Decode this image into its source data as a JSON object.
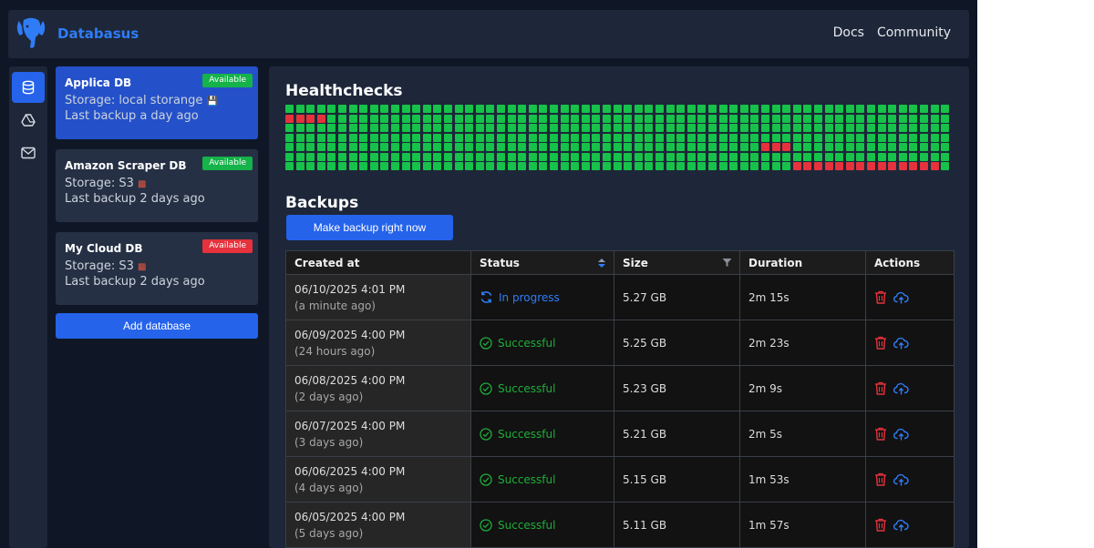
{
  "app": {
    "brand": "Databasus"
  },
  "nav": {
    "docs": "Docs",
    "community": "Community"
  },
  "sidebar": {
    "databases": [
      {
        "name": "Applica DB",
        "status": "Available",
        "storage": "Storage: local storange",
        "last_backup": "Last backup a day ago"
      },
      {
        "name": "Amazon Scraper DB",
        "status": "Available",
        "storage": "Storage: S3",
        "last_backup": "Last backup 2 days ago"
      },
      {
        "name": "My Cloud DB",
        "status": "Available",
        "storage": "Storage: S3",
        "last_backup": "Last backup 2 days ago"
      }
    ],
    "add_button": "Add database"
  },
  "healthchecks": {
    "title": "Healthchecks",
    "colors": {
      "ok": "#16c24a",
      "fail": "#e5323c"
    }
  },
  "backups": {
    "title": "Backups",
    "make_button": "Make backup right now",
    "columns": {
      "created": "Created at",
      "status": "Status",
      "size": "Size",
      "duration": "Duration",
      "actions": "Actions"
    },
    "rows": [
      {
        "created": "06/10/2025 4:01 PM",
        "ago": "(a minute ago)",
        "status": "In progress",
        "size": "5.27 GB",
        "duration": "2m 15s"
      },
      {
        "created": "06/09/2025 4:00 PM",
        "ago": "(24 hours ago)",
        "status": "Successful",
        "size": "5.25 GB",
        "duration": "2m 23s"
      },
      {
        "created": "06/08/2025 4:00 PM",
        "ago": "(2 days ago)",
        "status": "Successful",
        "size": "5.23 GB",
        "duration": "2m 9s"
      },
      {
        "created": "06/07/2025 4:00 PM",
        "ago": "(3 days ago)",
        "status": "Successful",
        "size": "5.21 GB",
        "duration": "2m 5s"
      },
      {
        "created": "06/06/2025 4:00 PM",
        "ago": "(4 days ago)",
        "status": "Successful",
        "size": "5.15 GB",
        "duration": "1m 53s"
      },
      {
        "created": "06/05/2025 4:00 PM",
        "ago": "(5 days ago)",
        "status": "Successful",
        "size": "5.11 GB",
        "duration": "1m 57s"
      }
    ]
  },
  "colors": {
    "accent": "#2563eb",
    "success": "#1fad3a",
    "danger": "#e5323c"
  }
}
